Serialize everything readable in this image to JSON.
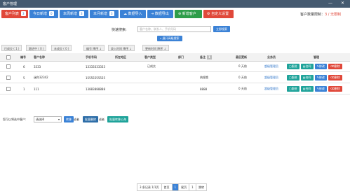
{
  "window": {
    "title": "客户管理",
    "min_glyph": "—",
    "close_glyph": "✕"
  },
  "toolbar": {
    "buttons": [
      {
        "label": "客户列表",
        "count": "3",
        "color": "#e0483a"
      },
      {
        "label": "今日新增",
        "count": "0",
        "color": "#3b82d6"
      },
      {
        "label": "本周新增",
        "count": "3",
        "color": "#3b82d6"
      },
      {
        "label": "本月新增",
        "count": "3",
        "color": "#3b82d6"
      },
      {
        "label": "数据导入",
        "icon": "cloud-upload-icon",
        "color": "#3b82d6"
      },
      {
        "label": "数据导出",
        "icon": "export-icon",
        "color": "#3b82d6"
      },
      {
        "label": "新增客户",
        "icon": "plus-icon",
        "color": "#2e9d4a"
      },
      {
        "label": "自定义设置",
        "icon": "gear-icon",
        "color": "#e0483a"
      }
    ],
    "quota_label": "客户数量限制：",
    "quota_value": "3 / 无限制"
  },
  "search": {
    "label": "快速搜索:",
    "placeholder": "客户名称、联系人、手机号码",
    "button": "立即搜索",
    "expand": "展开高级搜索"
  },
  "filters": [
    "已成交 ( 1 )",
    "跟进中 ( 0 )",
    "未成交 ( 0 )",
    "编号 降序 ↓",
    "录入时间 降序 ↓",
    "更新时间 降序 ↓"
  ],
  "table": {
    "columns": [
      "",
      "编号",
      "客户名称",
      "手机号码",
      "所在地区",
      "客户类型",
      "部门",
      "备注",
      "最后更新",
      "业务员",
      "管理"
    ],
    "remark_tag": "1",
    "rows": [
      {
        "id": "6",
        "name": "3333",
        "phone": "13333333333",
        "area": "",
        "type": "已成交",
        "dept": "",
        "remark": "",
        "updated": "0 天前",
        "agent": "超级管理员"
      },
      {
        "id": "5",
        "name": "迷你32342",
        "phone": "15555555555",
        "area": "",
        "type": "",
        "dept": "",
        "remark": "热搜哦",
        "updated": "0 天前",
        "agent": "超级管理员"
      },
      {
        "id": "1",
        "name": "111",
        "phone": "13883888888",
        "area": "",
        "type": "",
        "dept": "",
        "remark": "8888",
        "updated": "0 天前",
        "agent": "超级管理员"
      }
    ],
    "actions": [
      {
        "label": "跟进",
        "color": "#1fa39a"
      },
      {
        "label": "合同",
        "color": "#1fa39a"
      },
      {
        "label": "修改",
        "color": "#3b82d6"
      },
      {
        "label": "删除",
        "color": "#e0483a"
      }
    ]
  },
  "bulk": {
    "label": "您可以将选中客户:",
    "select_value": "请选择",
    "select_arrow": "▾",
    "btn_transfer": "转移",
    "or1": "或者",
    "btn_delete": "批量删除",
    "or2": "或者",
    "btn_public": "批量转移公海"
  },
  "pager": {
    "total": "3 条记录 1/1页",
    "first": "首页",
    "current": "1",
    "last": "尾页",
    "pages": "1",
    "jump": "跳转"
  }
}
